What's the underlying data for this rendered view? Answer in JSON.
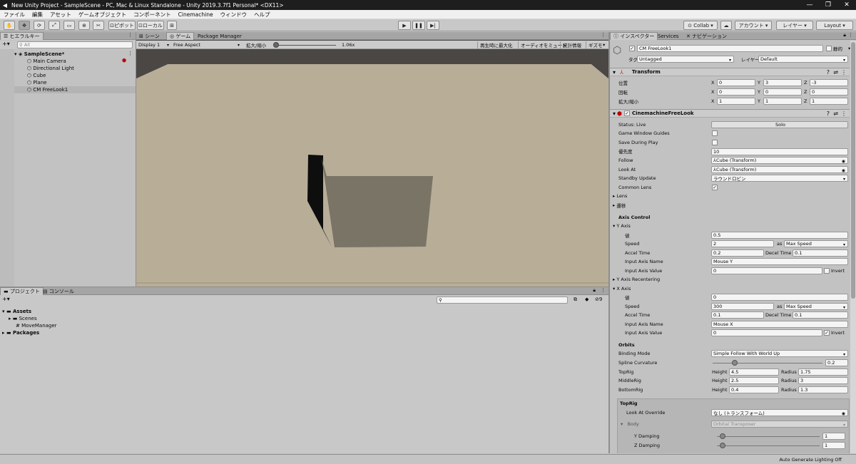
{
  "titlebar": {
    "title": "New Unity Project - SampleScene - PC, Mac & Linux Standalone - Unity 2019.3.7f1 Personal* <DX11>"
  },
  "menu": [
    "ファイル",
    "編集",
    "アセット",
    "ゲームオブジェクト",
    "コンポーネント",
    "Cinemachine",
    "ウィンドウ",
    "ヘルプ"
  ],
  "toolbar": {
    "pivot": "ピボット",
    "local": "ローカル",
    "collab": "Collab",
    "account": "アカウント",
    "layers": "レイヤー",
    "layout": "Layout"
  },
  "hierarchy": {
    "tab": "ヒエラルキー",
    "search_placeholder": "All",
    "scene": "SampleScene*",
    "items": [
      "Main Camera",
      "Directional Light",
      "Cube",
      "Plane",
      "CM FreeLook1"
    ]
  },
  "game": {
    "tabs": [
      "シーン",
      "ゲーム",
      "Package Manager"
    ],
    "display": "Display 1",
    "aspect": "Free Aspect",
    "scale_label": "拡大/縮小",
    "scale_value": "1.06x",
    "scale_fraction": 0.05,
    "buttons": [
      "再生時に最大化",
      "オーディオをミュート",
      "統計情報",
      "ギズモ"
    ]
  },
  "project": {
    "tabs": [
      "プロジェクト",
      "コンソール"
    ],
    "assets": "Assets",
    "scenes": "Scenes",
    "script": "MoveManager",
    "packages": "Packages",
    "count": "9"
  },
  "status": {
    "text": "Auto Generate Lighting Off"
  },
  "inspector": {
    "tabs": [
      "インスペクター",
      "Services",
      "ナビゲーション"
    ],
    "name": "CM FreeLook1",
    "static_label": "静的",
    "tag_label": "タグ",
    "tag_value": "Untagged",
    "layer_label": "レイヤー",
    "layer_value": "Default",
    "transform": {
      "title": "Transform",
      "position_label": "位置",
      "rotation_label": "回転",
      "scale_label": "拡大/縮小",
      "position": [
        "0",
        "3",
        "-3"
      ],
      "rotation": [
        "0",
        "0",
        "0"
      ],
      "scale": [
        "1",
        "1",
        "1"
      ],
      "axes": [
        "X",
        "Y",
        "Z"
      ]
    },
    "freelook": {
      "title": "CinemachineFreeLook",
      "status": "Status: Live",
      "solo": "Solo",
      "game_window_guides": "Game Window Guides",
      "save_during_play": "Save During Play",
      "priority_label": "優先度",
      "priority": "10",
      "follow_label": "Follow",
      "follow": "Cube (Transform)",
      "lookat_label": "Look At",
      "lookat": "Cube (Transform)",
      "standby_label": "Standby Update",
      "standby": "ラウンドロビン",
      "common_lens": "Common Lens",
      "common_lens_check": "✓",
      "lens": "Lens",
      "transitions": "遷移",
      "axis_control": "Axis Control",
      "y_axis": {
        "title": "Y Axis",
        "value_label": "値",
        "value": "0.5",
        "speed_label": "Speed",
        "speed": "2",
        "speed_mode": "Max Speed",
        "accel_label": "Accel Time",
        "accel": "0.2",
        "decel_label": "Decel Time",
        "decel": "0.1",
        "input_name_label": "Input Axis Name",
        "input_name": "Mouse Y",
        "input_value_label": "Input Axis Value",
        "input_value": "0",
        "invert": "Invert",
        "invert_check": ""
      },
      "y_recentering": "Y Axis Recentering",
      "x_axis": {
        "title": "X Axis",
        "value_label": "値",
        "value": "0",
        "speed_label": "Speed",
        "speed": "300",
        "speed_mode": "Max Speed",
        "accel_label": "Accel Time",
        "accel": "0.1",
        "decel_label": "Decel Time",
        "decel": "0.1",
        "input_name_label": "Input Axis Name",
        "input_name": "Mouse X",
        "input_value_label": "Input Axis Value",
        "input_value": "0",
        "invert": "Invert",
        "invert_check": "✓"
      },
      "as": "as",
      "orbits": "Orbits",
      "binding_label": "Binding Mode",
      "binding": "Simple Follow With World Up",
      "spline_label": "Spline Curvature",
      "spline": "0.2",
      "spline_fraction": 0.2,
      "rigs": [
        {
          "name": "TopRig",
          "height": "4.5",
          "radius": "1.75"
        },
        {
          "name": "MiddleRig",
          "height": "2.5",
          "radius": "3"
        },
        {
          "name": "BottomRig",
          "height": "0.4",
          "radius": "1.3"
        }
      ],
      "height_label": "Height",
      "radius_label": "Radius",
      "toprig_section": "TopRig",
      "lookat_override_label": "Look At Override",
      "lookat_override": "なし (トランスフォーム)",
      "body_label": "Body",
      "body": "Orbital Transposer",
      "y_damping_label": "Y Damping",
      "y_damping": "1",
      "z_damping_label": "Z Damping",
      "z_damping": "1"
    }
  }
}
